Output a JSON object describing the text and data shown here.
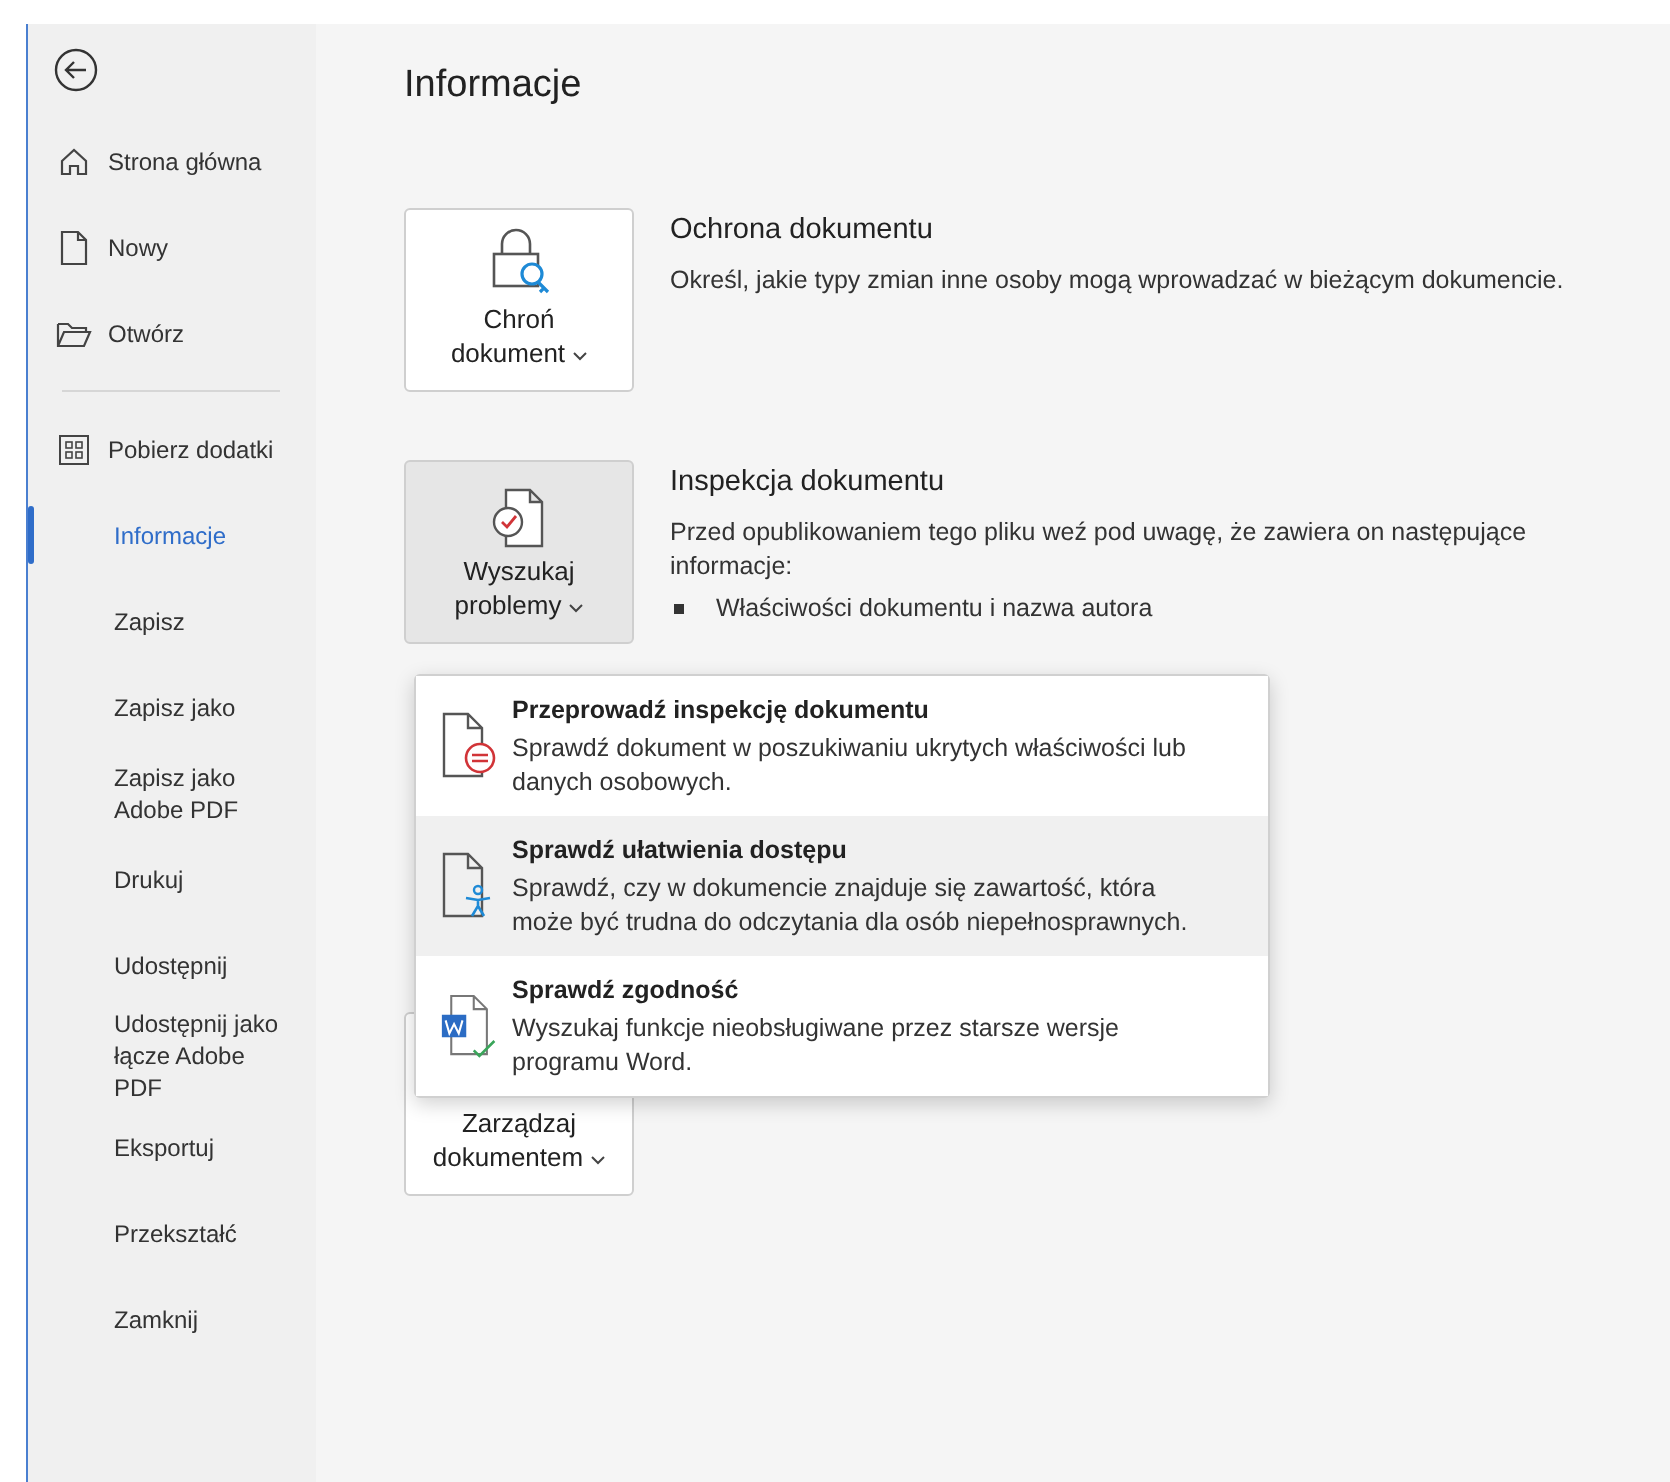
{
  "sidebar": {
    "items": [
      {
        "kind": "home",
        "label": "Strona główna",
        "selected": false
      },
      {
        "kind": "new",
        "label": "Nowy",
        "selected": false
      },
      {
        "kind": "open",
        "label": "Otwórz",
        "selected": false
      }
    ],
    "more_items": [
      {
        "kind": "addins",
        "label": "Pobierz dodatki",
        "selected": false
      },
      {
        "kind": "text",
        "label": "Informacje",
        "selected": true
      },
      {
        "kind": "text",
        "label": "Zapisz",
        "selected": false
      },
      {
        "kind": "text",
        "label": "Zapisz jako",
        "selected": false
      },
      {
        "kind": "text",
        "label": "Zapisz jako Adobe PDF",
        "selected": false
      },
      {
        "kind": "text",
        "label": "Drukuj",
        "selected": false
      },
      {
        "kind": "text",
        "label": "Udostępnij",
        "selected": false
      },
      {
        "kind": "text",
        "label": "Udostępnij jako łącze Adobe PDF",
        "selected": false
      },
      {
        "kind": "text",
        "label": "Eksportuj",
        "selected": false
      },
      {
        "kind": "text",
        "label": "Przekształć",
        "selected": false
      },
      {
        "kind": "text",
        "label": "Zamknij",
        "selected": false
      }
    ]
  },
  "page_title": "Informacje",
  "sections": [
    {
      "kind": "protect",
      "button": [
        "Chroń",
        "dokument"
      ],
      "pressed": false,
      "title": "Ochrona dokumentu",
      "description": "Określ, jakie typy zmian inne osoby mogą wprowadzać w bieżącym dokumencie."
    },
    {
      "kind": "inspect",
      "button": [
        "Wyszukaj",
        "problemy"
      ],
      "pressed": true,
      "title": "Inspekcja dokumentu",
      "description": "Przed opublikowaniem tego pliku weź pod uwagę, że zawiera on następujące informacje:",
      "bullets": [
        "Właściwości dokumentu i nazwa autora"
      ]
    },
    {
      "kind": "manage",
      "button": [
        "Zarządzaj",
        "dokumentem"
      ],
      "pressed": false
    }
  ],
  "menu": {
    "items": [
      {
        "kind": "inspect",
        "title": "Przeprowadź inspekcję dokumentu",
        "description": "Sprawdź dokument w poszukiwaniu ukrytych właściwości lub danych osobowych.",
        "selected": false
      },
      {
        "kind": "accessibility",
        "title": "Sprawdź ułatwienia dostępu",
        "description": "Sprawdź, czy w dokumencie znajduje się zawartość, która może być trudna do odczytania dla osób niepełnosprawnych.",
        "selected": true
      },
      {
        "kind": "compatibility",
        "title": "Sprawdź zgodność",
        "description": "Wyszukaj funkcje nieobsługiwane przez starsze wersje programu Word.",
        "selected": false
      }
    ]
  }
}
